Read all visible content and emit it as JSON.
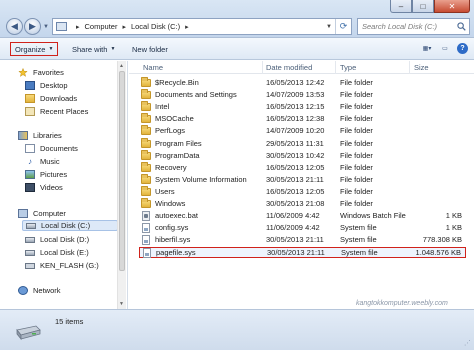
{
  "address": {
    "crumbs": [
      "Computer",
      "Local Disk (C:)"
    ]
  },
  "search": {
    "placeholder": "Search Local Disk (C:)"
  },
  "toolbar": {
    "organize_label": "Organize",
    "share_label": "Share with",
    "new_folder_label": "New folder"
  },
  "sidebar": {
    "favorites_label": "Favorites",
    "favorites": [
      "Desktop",
      "Downloads",
      "Recent Places"
    ],
    "libraries_label": "Libraries",
    "libraries": [
      "Documents",
      "Music",
      "Pictures",
      "Videos"
    ],
    "computer_label": "Computer",
    "drives": [
      "Local Disk (C:)",
      "Local Disk (D:)",
      "Local Disk (E:)",
      "KEN_FLASH (G:)"
    ],
    "network_label": "Network",
    "selected": "Local Disk (C:)"
  },
  "columns": {
    "name": "Name",
    "date": "Date modified",
    "type": "Type",
    "size": "Size"
  },
  "files": [
    {
      "name": "$Recycle.Bin",
      "date": "16/05/2013 12:42",
      "type": "File folder",
      "size": "",
      "icon": "folder-icon"
    },
    {
      "name": "Documents and Settings",
      "date": "14/07/2009 13:53",
      "type": "File folder",
      "size": "",
      "icon": "folder-icon"
    },
    {
      "name": "Intel",
      "date": "16/05/2013 12:15",
      "type": "File folder",
      "size": "",
      "icon": "folder-icon"
    },
    {
      "name": "MSOCache",
      "date": "16/05/2013 12:38",
      "type": "File folder",
      "size": "",
      "icon": "folder-icon"
    },
    {
      "name": "PerfLogs",
      "date": "14/07/2009 10:20",
      "type": "File folder",
      "size": "",
      "icon": "folder-icon"
    },
    {
      "name": "Program Files",
      "date": "29/05/2013 11:31",
      "type": "File folder",
      "size": "",
      "icon": "folder-icon"
    },
    {
      "name": "ProgramData",
      "date": "30/05/2013 10:42",
      "type": "File folder",
      "size": "",
      "icon": "folder-icon"
    },
    {
      "name": "Recovery",
      "date": "16/05/2013 12:05",
      "type": "File folder",
      "size": "",
      "icon": "folder-icon"
    },
    {
      "name": "System Volume Information",
      "date": "30/05/2013 21:11",
      "type": "File folder",
      "size": "",
      "icon": "folder-icon"
    },
    {
      "name": "Users",
      "date": "16/05/2013 12:05",
      "type": "File folder",
      "size": "",
      "icon": "folder-icon"
    },
    {
      "name": "Windows",
      "date": "30/05/2013 21:08",
      "type": "File folder",
      "size": "",
      "icon": "folder-icon"
    },
    {
      "name": "autoexec.bat",
      "date": "11/06/2009 4:42",
      "type": "Windows Batch File",
      "size": "1 KB",
      "icon": "batch-file-icon"
    },
    {
      "name": "config.sys",
      "date": "11/06/2009 4:42",
      "type": "System file",
      "size": "1 KB",
      "icon": "system-file-icon"
    },
    {
      "name": "hiberfil.sys",
      "date": "30/05/2013 21:11",
      "type": "System file",
      "size": "778.308 KB",
      "icon": "system-file-icon"
    },
    {
      "name": "pagefile.sys",
      "date": "30/05/2013 21:11",
      "type": "System file",
      "size": "1.048.576 KB",
      "icon": "system-file-icon"
    }
  ],
  "highlighted_file": "pagefile.sys",
  "watermark": "kangtokkomputer.weebly.com",
  "status": {
    "item_count": "15 items"
  },
  "colors": {
    "highlight_border": "#d0221b",
    "selection_bg": "#dde9f8",
    "toolbar_bg": "#dfe9f5"
  }
}
